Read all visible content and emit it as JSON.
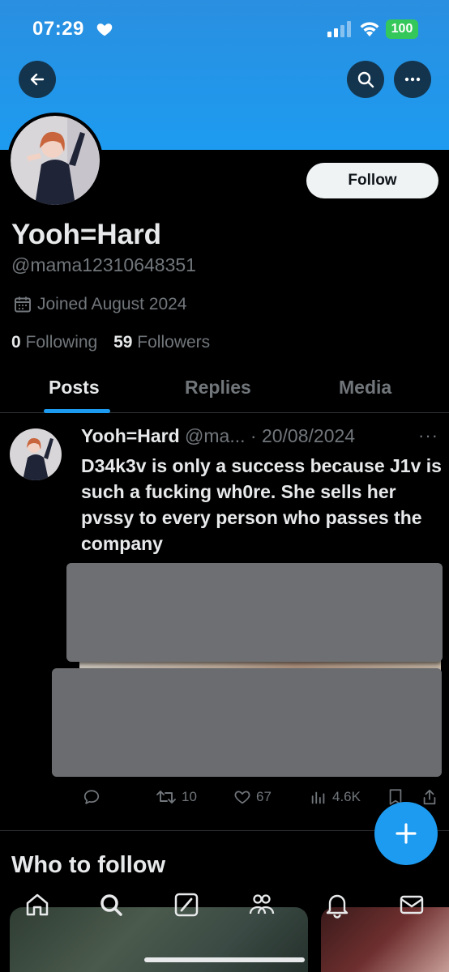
{
  "status_bar": {
    "time": "07:29",
    "battery": "100"
  },
  "header": {
    "follow_label": "Follow"
  },
  "profile": {
    "name": "Yooh=Hard",
    "handle": "@mama12310648351",
    "joined": "Joined August 2024",
    "following_count": "0",
    "following_label": "Following",
    "followers_count": "59",
    "followers_label": "Followers"
  },
  "tabs": [
    {
      "label": "Posts",
      "active": true
    },
    {
      "label": "Replies",
      "active": false
    },
    {
      "label": "Media",
      "active": false
    }
  ],
  "tweet": {
    "name": "Yooh=Hard",
    "handle": "@ma...",
    "separator": "·",
    "date": "20/08/2024",
    "text": "D34k3v is only a success because J1v is such a fucking wh0re. She sells her pvssy to every person who passes the company",
    "retweets": "10",
    "likes": "67",
    "views": "4.6K"
  },
  "who_to_follow": {
    "title": "Who to follow"
  },
  "colors": {
    "accent": "#1d9bf0",
    "background": "#000000",
    "secondary_text": "#71767b"
  }
}
